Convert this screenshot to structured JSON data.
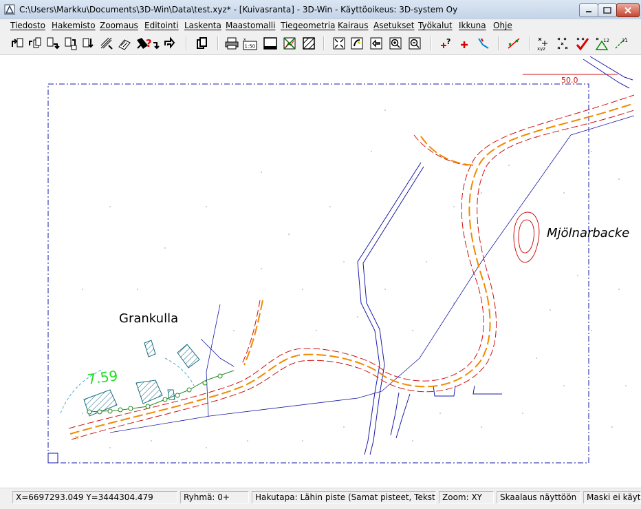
{
  "window": {
    "title": "C:\\Users\\Markku\\Documents\\3D-Win\\Data\\test.xyz* - [Kuivasranta] - 3D-Win - Käyttöoikeus: 3D-system Oy"
  },
  "menu": [
    "Tiedosto",
    "Hakemisto",
    "Zoomaus",
    "Editointi",
    "Laskenta",
    "Maastomalli",
    "Tiegeometria",
    "Kairaus",
    "Asetukset",
    "Työkalut",
    "Ikkuna",
    "Ohje"
  ],
  "toolbar": {
    "scale_icon_label": "1:50"
  },
  "map": {
    "scale_label": "50.0",
    "place_labels": [
      "Grankulla",
      "Mjölnarbacke"
    ],
    "elevation_label": "7.59",
    "colors": {
      "road": "#f08a00",
      "road_edge": "#d01010",
      "water": "#1a1aa8",
      "frame": "#1a1aa8",
      "label_green": "#22dd22"
    }
  },
  "status": {
    "coords": "X=6697293.049  Y=3444304.479",
    "group": "Ryhmä: 0+",
    "search": "Hakutapa: Lähin piste (Samat pisteet, Tekstit)",
    "zoom": "Zoom: XY",
    "scaling": "Skaalaus näyttöön",
    "mask": "Maski ei käytössä"
  }
}
